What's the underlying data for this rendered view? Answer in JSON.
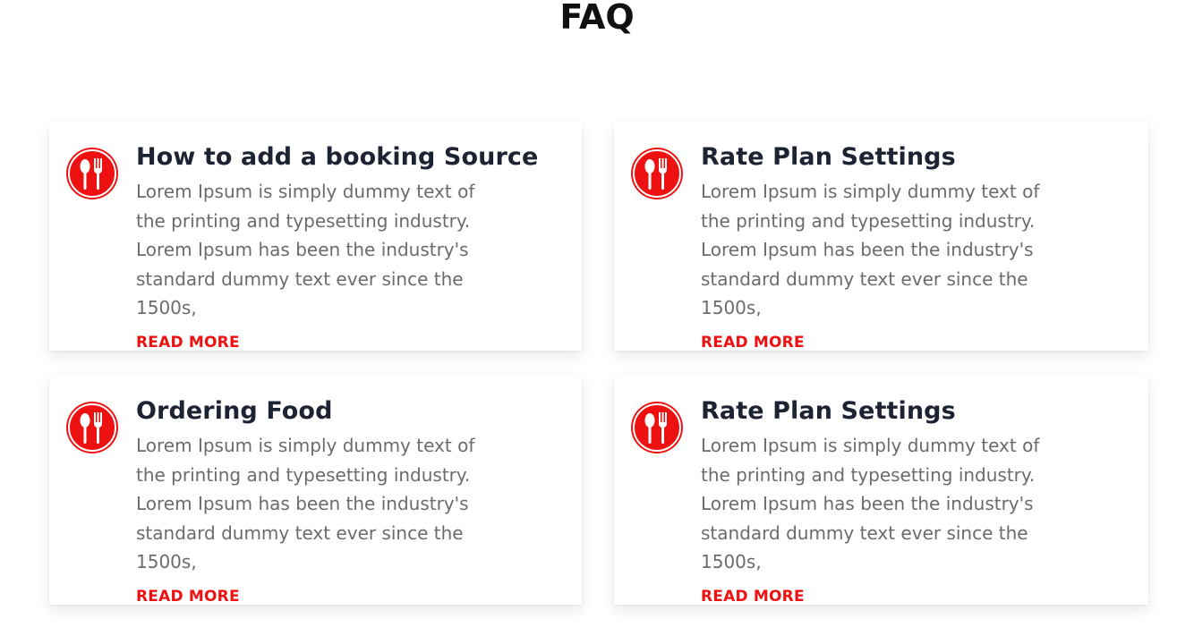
{
  "page": {
    "title": "FAQ"
  },
  "colors": {
    "accent": "#ee1111",
    "title_text": "#1e2334",
    "body_text": "#6b6b6b"
  },
  "cards": [
    {
      "icon": "utensils-icon",
      "title": "How to add a booking Source",
      "text": "Lorem Ipsum is simply dummy text of the printing and typesetting industry. Lorem Ipsum has been the industry's standard dummy text ever since the 1500s,",
      "link": "READ MORE"
    },
    {
      "icon": "utensils-icon",
      "title": "Rate Plan Settings",
      "text": "Lorem Ipsum is simply dummy text of the printing and typesetting industry. Lorem Ipsum has been the industry's standard dummy text ever since the 1500s,",
      "link": "READ MORE"
    },
    {
      "icon": "utensils-icon",
      "title": "Ordering Food",
      "text": "Lorem Ipsum is simply dummy text of the printing and typesetting industry. Lorem Ipsum has been the industry's standard dummy text ever since the 1500s,",
      "link": "READ MORE"
    },
    {
      "icon": "utensils-icon",
      "title": "Rate Plan Settings",
      "text": "Lorem Ipsum is simply dummy text of the printing and typesetting industry. Lorem Ipsum has been the industry's standard dummy text ever since the 1500s,",
      "link": "READ MORE"
    }
  ]
}
